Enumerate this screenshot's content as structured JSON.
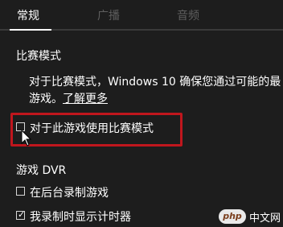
{
  "tabs": [
    {
      "label": "常规",
      "active": true
    },
    {
      "label": "广播",
      "active": false
    },
    {
      "label": "音频",
      "active": false
    }
  ],
  "game_mode": {
    "title": "比赛模式",
    "description_line1": "对于比赛模式，Windows 10 确保您通过可能的最",
    "description_line2": "游戏。",
    "learn_more": "了解更多",
    "checkbox_label": "对于此游戏使用比赛模式",
    "checked": false
  },
  "dvr": {
    "title": "游戏 DVR",
    "options": [
      {
        "label": "在后台录制游戏",
        "checked": false
      },
      {
        "label": "我录制时显示计时器",
        "checked": true
      }
    ]
  },
  "watermark": {
    "badge": "php",
    "text": "中文网"
  },
  "colors": {
    "background": "#1d1d1d",
    "highlight": "#c0161d",
    "inactive_tab": "#5e5e5e"
  },
  "icons": {
    "cursor": "mouse-pointer-icon",
    "check": "checkmark-icon"
  }
}
